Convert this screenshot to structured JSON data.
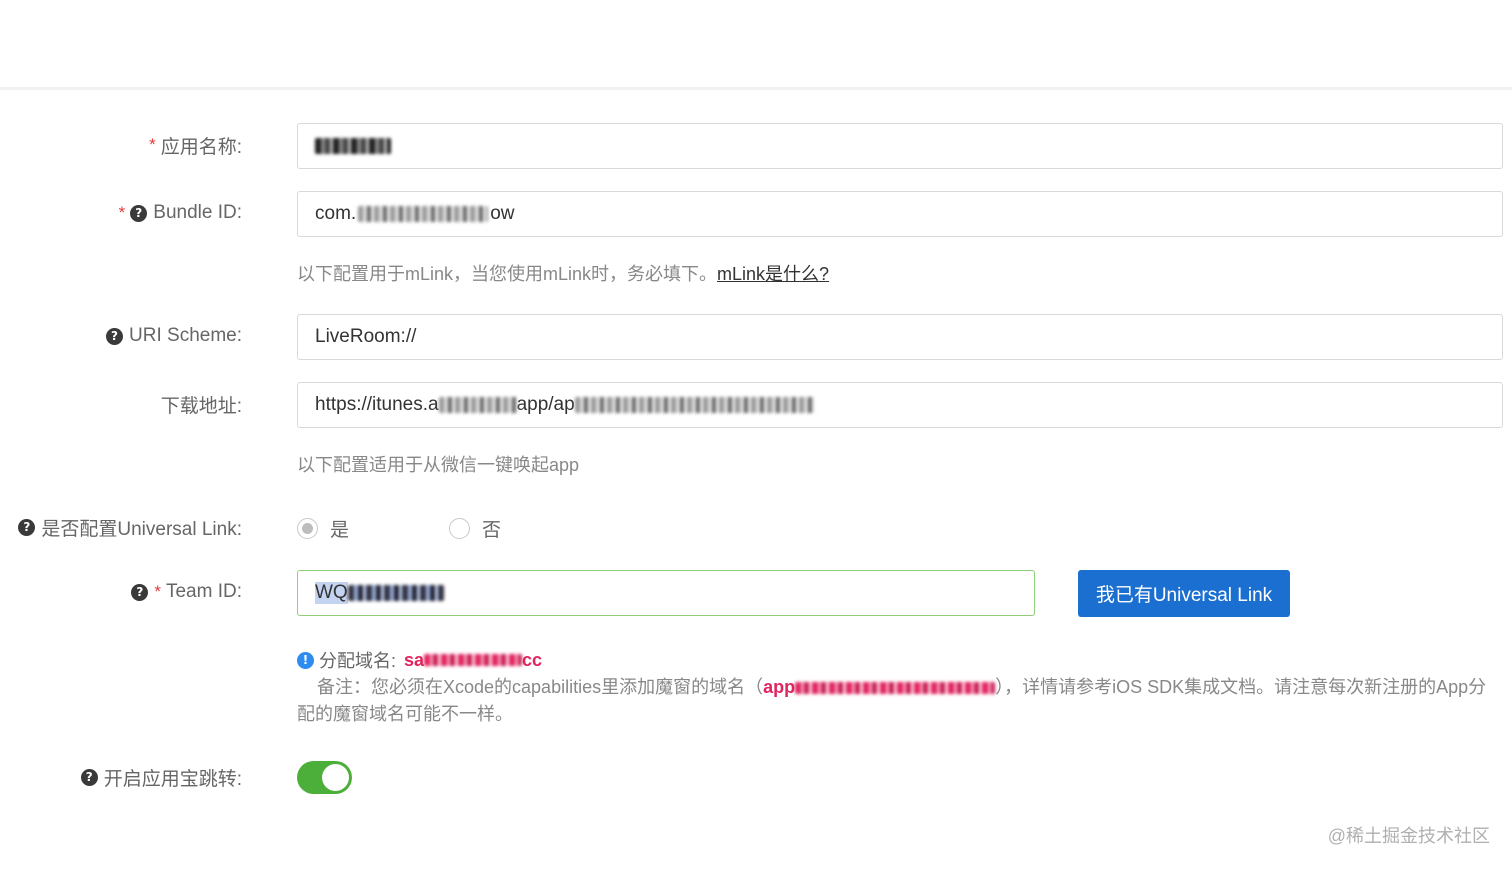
{
  "form": {
    "app_name": {
      "label": "应用名称:",
      "value_prefix": "",
      "required": true
    },
    "bundle_id": {
      "label": "Bundle ID:",
      "value_prefix": "com.",
      "value_suffix": "ow",
      "required": true
    },
    "mlink_hint": {
      "text": "以下配置用于mLink，当您使用mLink时，务必填下。",
      "link": "mLink是什么? "
    },
    "uri_scheme": {
      "label": "URI Scheme:",
      "value": "LiveRoom://"
    },
    "download_url": {
      "label": "下载地址:",
      "value_prefix": "https://itunes.a",
      "value_mid": "app/ap"
    },
    "wechat_hint": {
      "text": "以下配置适用于从微信一键唤起app"
    },
    "universal_link": {
      "label": "是否配置Universal Link:",
      "options": [
        "是",
        "否"
      ],
      "selected": "是"
    },
    "team_id": {
      "label": "Team ID:",
      "value_prefix": "WQ",
      "required": true
    },
    "have_universal_link_button": "我已有Universal Link",
    "domain_info": {
      "label": "分配域名:",
      "value_prefix": "sa",
      "value_suffix": "cc"
    },
    "note": {
      "prefix": "备注：您必须在Xcode的capabilities里添加魔窗的域名（",
      "highlight_prefix": "app",
      "suffix": "），详情请参考iOS SDK集成文档。请注意每次新注册的App分配的魔窗域名可能不一样。"
    },
    "appstore_jump": {
      "label": "开启应用宝跳转:",
      "enabled": true
    }
  },
  "watermark": "@稀土掘金技术社区",
  "colors": {
    "primary": "#1a6fd0",
    "toggle_on": "#4caf3a",
    "required": "#e4393c",
    "highlight": "#e0245e"
  }
}
